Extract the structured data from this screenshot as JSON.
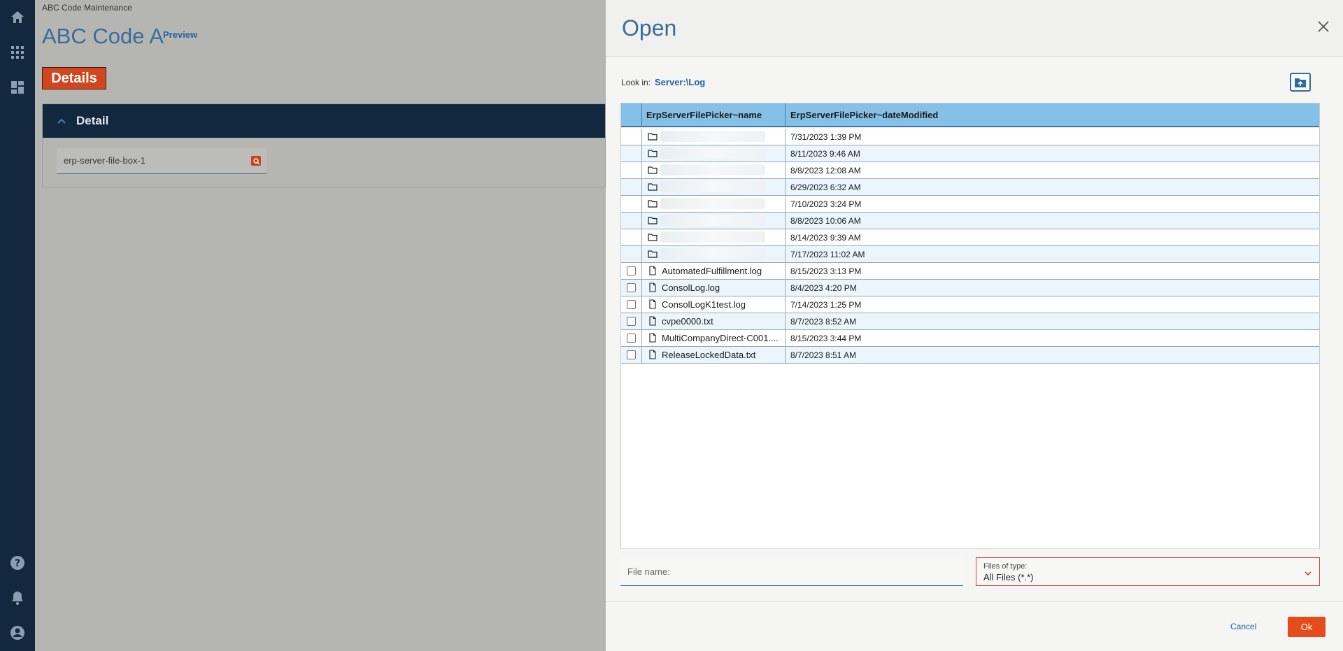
{
  "app": {
    "breadcrumb": "ABC Code Maintenance",
    "title": "ABC Code A",
    "preview_link": "Preview",
    "details_button": "Details",
    "detail_section_label": "Detail",
    "file_box_value": "erp-server-file-box-1"
  },
  "rail": {
    "icons": [
      "home-icon",
      "apps-grid-icon",
      "dashboard-icon",
      "help-icon",
      "bell-icon",
      "user-account-icon"
    ]
  },
  "dialog": {
    "title": "Open",
    "look_in_label": "Look in:",
    "look_in_path": "Server:\\Log",
    "columns": {
      "name": "ErpServerFilePicker~name",
      "date": "ErpServerFilePicker~dateModified"
    },
    "rows": [
      {
        "type": "folder",
        "name": "",
        "date": "7/31/2023 1:39 PM"
      },
      {
        "type": "folder",
        "name": "",
        "date": "8/11/2023 9:46 AM"
      },
      {
        "type": "folder",
        "name": "",
        "date": "8/8/2023 12:08 AM"
      },
      {
        "type": "folder",
        "name": "",
        "date": "6/29/2023 6:32 AM"
      },
      {
        "type": "folder",
        "name": "",
        "date": "7/10/2023 3:24 PM"
      },
      {
        "type": "folder",
        "name": "",
        "date": "8/8/2023 10:06 AM"
      },
      {
        "type": "folder",
        "name": "",
        "date": "8/14/2023 9:39 AM"
      },
      {
        "type": "folder",
        "name": "",
        "date": "7/17/2023 11:02 AM"
      },
      {
        "type": "file",
        "name": "AutomatedFulfillment.log",
        "date": "8/15/2023 3:13 PM"
      },
      {
        "type": "file",
        "name": "ConsolLog.log",
        "date": "8/4/2023 4:20 PM"
      },
      {
        "type": "file",
        "name": "ConsolLogK1test.log",
        "date": "7/14/2023 1:25 PM"
      },
      {
        "type": "file",
        "name": "cvpe0000.txt",
        "date": "8/7/2023 8:52 AM"
      },
      {
        "type": "file",
        "name": "MultiCompanyDirect-C001....",
        "date": "8/15/2023 3:44 PM"
      },
      {
        "type": "file",
        "name": "ReleaseLockedData.txt",
        "date": "8/7/2023 8:51 AM"
      }
    ],
    "file_name_placeholder": "File name:",
    "files_of_type_label": "Files of type:",
    "files_of_type_value": "All Files (*.*)",
    "cancel_label": "Cancel",
    "ok_label": "Ok"
  },
  "colors": {
    "rail_bg": "#12283f",
    "accent_blue": "#3b6c9b",
    "details_orange": "#d2461f",
    "ok_orange": "#e44c1c",
    "grid_header": "#85c1e6"
  }
}
